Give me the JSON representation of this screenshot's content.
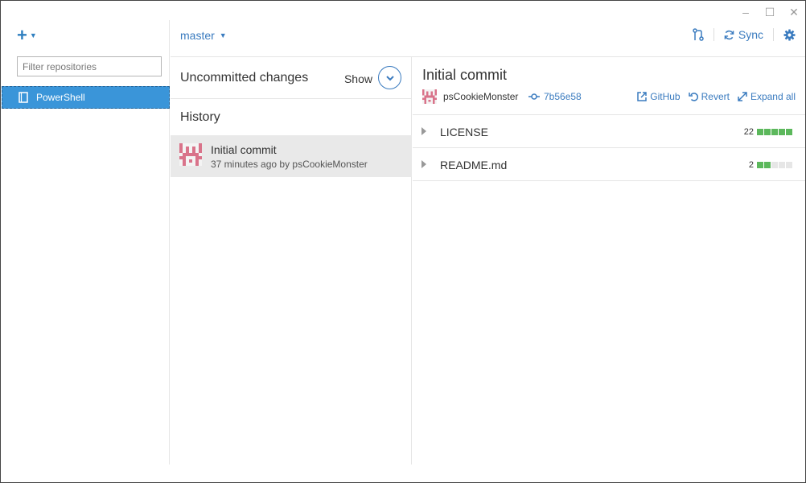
{
  "window": {
    "minimize": "–",
    "maximize": "☐",
    "close": "✕"
  },
  "sidebar": {
    "add_icon": "plus-icon",
    "filter_placeholder": "Filter repositories",
    "repositories": [
      {
        "name": "PowerShell",
        "selected": true
      }
    ]
  },
  "toolbar": {
    "branch": "master",
    "sync_label": "Sync"
  },
  "uncommitted": {
    "title": "Uncommitted changes",
    "show_label": "Show"
  },
  "history": {
    "title": "History",
    "commits": [
      {
        "message": "Initial commit",
        "meta": "37 minutes ago by psCookieMonster",
        "selected": true
      }
    ]
  },
  "detail": {
    "title": "Initial commit",
    "author": "psCookieMonster",
    "sha": "7b56e58",
    "actions": {
      "github": "GitHub",
      "revert": "Revert",
      "expand": "Expand all"
    },
    "files": [
      {
        "name": "LICENSE",
        "additions": "22",
        "bars_on": 5,
        "bars_total": 5
      },
      {
        "name": "README.md",
        "additions": "2",
        "bars_on": 2,
        "bars_total": 5
      }
    ]
  },
  "colors": {
    "accent": "#3a7bbf",
    "selected": "#3a95d9",
    "diff_add": "#5cb85c",
    "avatar": "#d9738a"
  }
}
